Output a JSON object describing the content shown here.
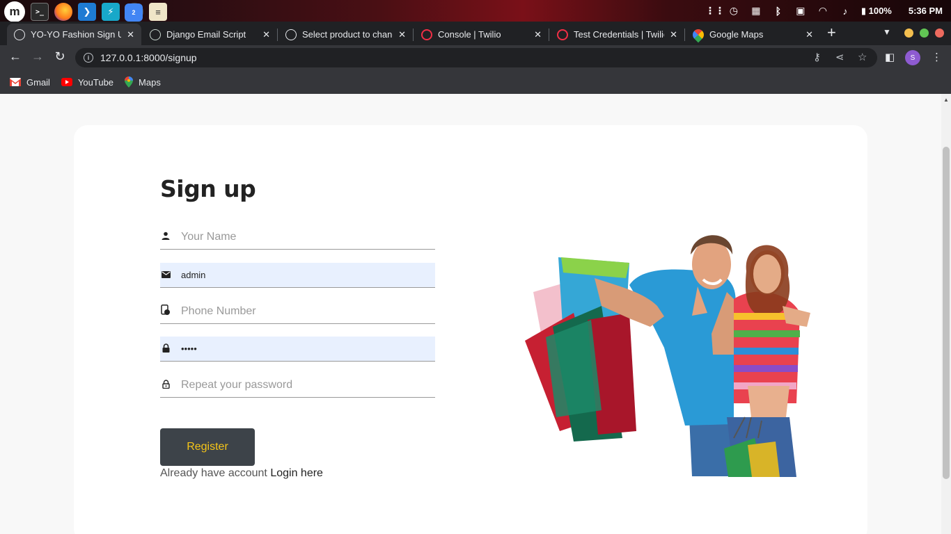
{
  "os": {
    "battery": "100%",
    "clock": "5:36 PM",
    "chrome_badge": "2",
    "apps": [
      "mint-menu-icon",
      "terminal-icon",
      "firefox-icon",
      "vscode-icon",
      "bolt-icon",
      "chrome-icon",
      "notes-icon"
    ]
  },
  "tabs": [
    {
      "title": "YO-YO Fashion Sign Up",
      "favicon": "globe-icon"
    },
    {
      "title": "Django Email Script",
      "favicon": "chatgpt-icon"
    },
    {
      "title": "Select product to change",
      "favicon": "globe-icon"
    },
    {
      "title": "Console | Twilio",
      "favicon": "twilio-icon"
    },
    {
      "title": "Test Credentials | Twilio",
      "favicon": "twilio-icon"
    },
    {
      "title": "Google Maps",
      "favicon": "maps-icon"
    }
  ],
  "address": {
    "url": "127.0.0.1:8000/signup",
    "profile_initial": "S"
  },
  "bookmarks": [
    {
      "label": "Gmail",
      "icon": "gmail-icon"
    },
    {
      "label": "YouTube",
      "icon": "youtube-icon"
    },
    {
      "label": "Maps",
      "icon": "maps-icon"
    }
  ],
  "form": {
    "title": "Sign up",
    "name_placeholder": "Your Name",
    "email_value": "admin",
    "phone_placeholder": "Phone Number",
    "password_value": "•••••",
    "repeat_placeholder": "Repeat your password",
    "register_label": "Register",
    "login_prompt": "Already have account",
    "login_link": "Login here"
  },
  "colors": {
    "register_bg": "#3d4349",
    "register_text": "#f5c518",
    "autofill_bg": "#e8f0fe"
  }
}
